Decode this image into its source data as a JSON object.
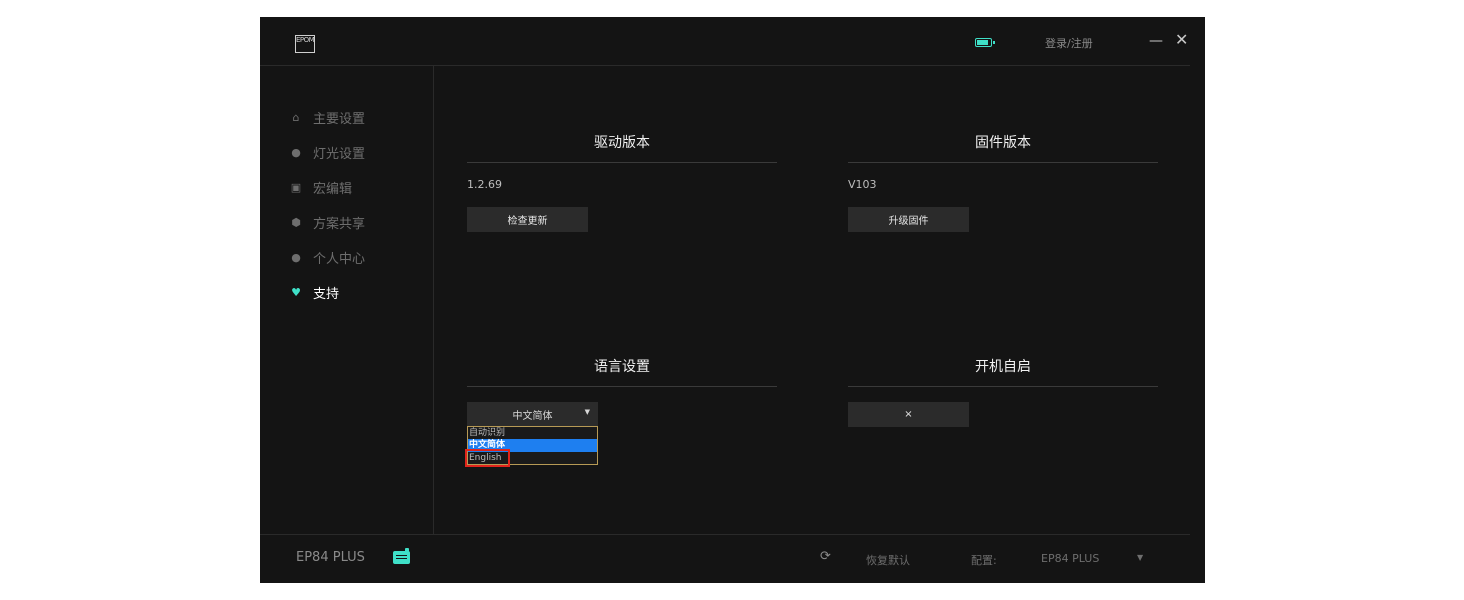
{
  "titlebar": {
    "logo_text": "EPOM",
    "login_label": "登录/注册",
    "minimize_label": "—",
    "close_label": "✕"
  },
  "sidebar": {
    "items": [
      {
        "label": "主要设置",
        "icon": "home-icon",
        "glyph": "⌂"
      },
      {
        "label": "灯光设置",
        "icon": "bulb-icon",
        "glyph": "●"
      },
      {
        "label": "宏编辑",
        "icon": "macro-icon",
        "glyph": "▣"
      },
      {
        "label": "方案共享",
        "icon": "cube-icon",
        "glyph": "⬢"
      },
      {
        "label": "个人中心",
        "icon": "user-icon",
        "glyph": "●"
      },
      {
        "label": "支持",
        "icon": "heart-icon",
        "glyph": "♥"
      }
    ],
    "active_index": 5
  },
  "driver": {
    "title": "驱动版本",
    "version": "1.2.69",
    "button": "检查更新"
  },
  "firmware": {
    "title": "固件版本",
    "version": "V103",
    "button": "升级固件"
  },
  "language": {
    "title": "语言设置",
    "selected": "中文简体",
    "options": [
      "自动识别",
      "中文简体",
      "English"
    ]
  },
  "autostart": {
    "title": "开机自启",
    "value": "×"
  },
  "footer": {
    "model": "EP84 PLUS",
    "reset_label": "恢复默认",
    "config_label": "配置:",
    "config_value": "EP84 PLUS"
  },
  "colors": {
    "accent": "#3fe0c8",
    "background": "#141414",
    "highlight_box": "#e0241b",
    "selected_option": "#1e7ff0"
  }
}
